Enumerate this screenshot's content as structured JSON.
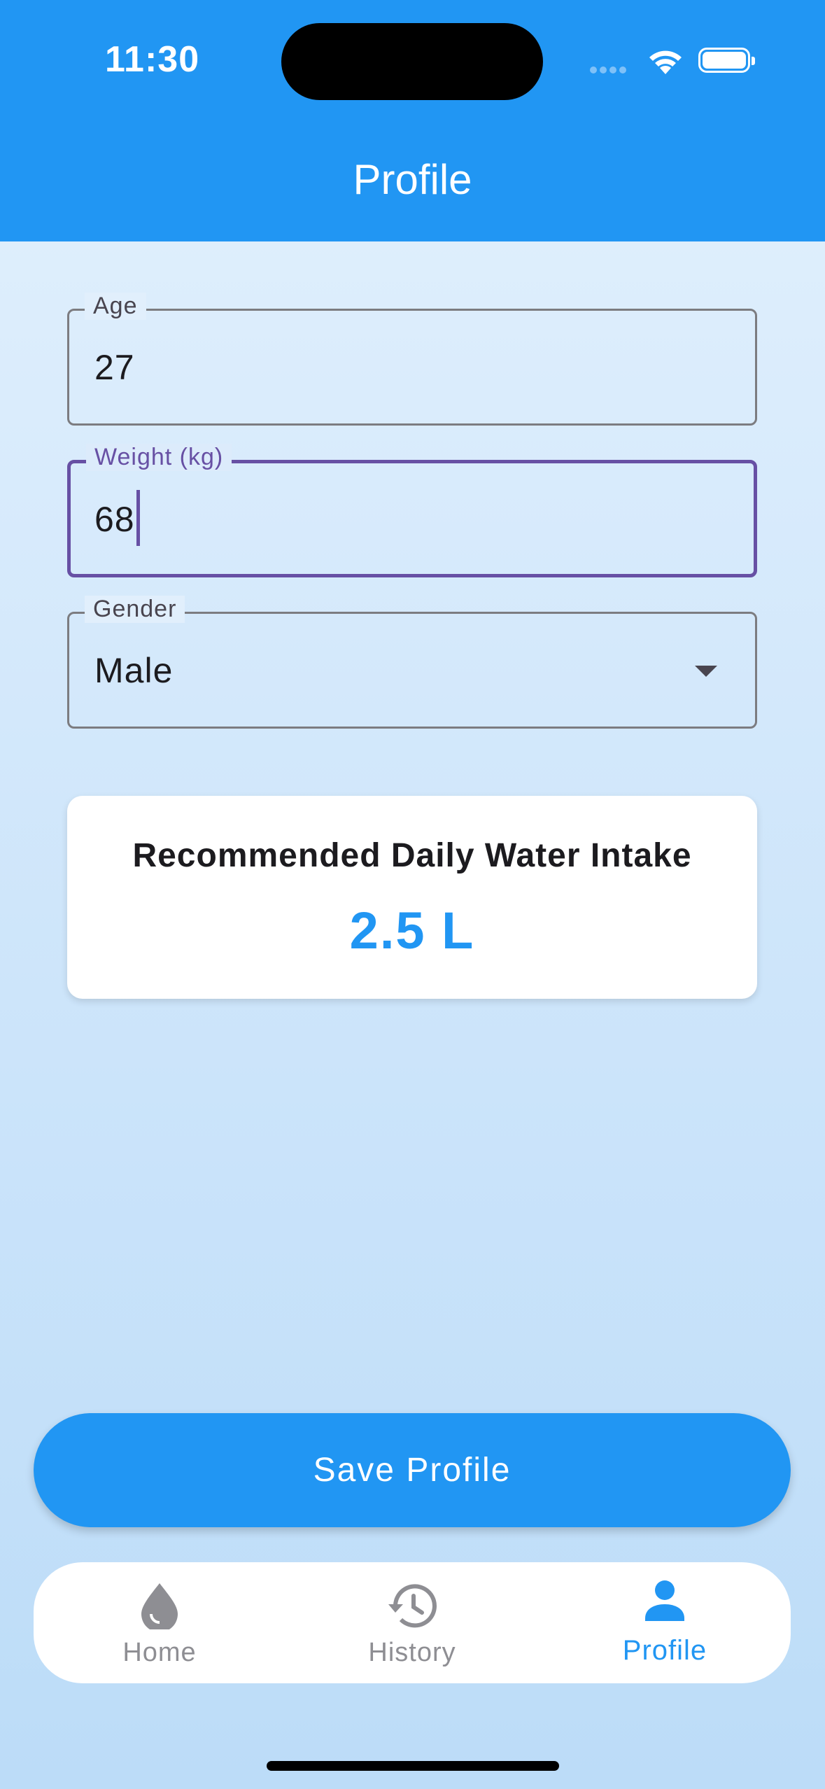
{
  "status_bar": {
    "time": "11:30"
  },
  "app_bar": {
    "title": "Profile"
  },
  "form": {
    "age": {
      "label": "Age",
      "value": "27"
    },
    "weight": {
      "label": "Weight (kg)",
      "value": "68"
    },
    "gender": {
      "label": "Gender",
      "value": "Male"
    }
  },
  "recommendation": {
    "title": "Recommended Daily Water Intake",
    "value": "2.5 L"
  },
  "save_button": {
    "label": "Save Profile"
  },
  "bottom_nav": {
    "items": [
      {
        "label": "Home",
        "icon": "water-drop-icon",
        "active": false
      },
      {
        "label": "History",
        "icon": "history-icon",
        "active": false
      },
      {
        "label": "Profile",
        "icon": "person-icon",
        "active": true
      }
    ]
  },
  "colors": {
    "primary": "#2196f3",
    "focus": "#6750a4",
    "inactive": "#8e8e93"
  }
}
